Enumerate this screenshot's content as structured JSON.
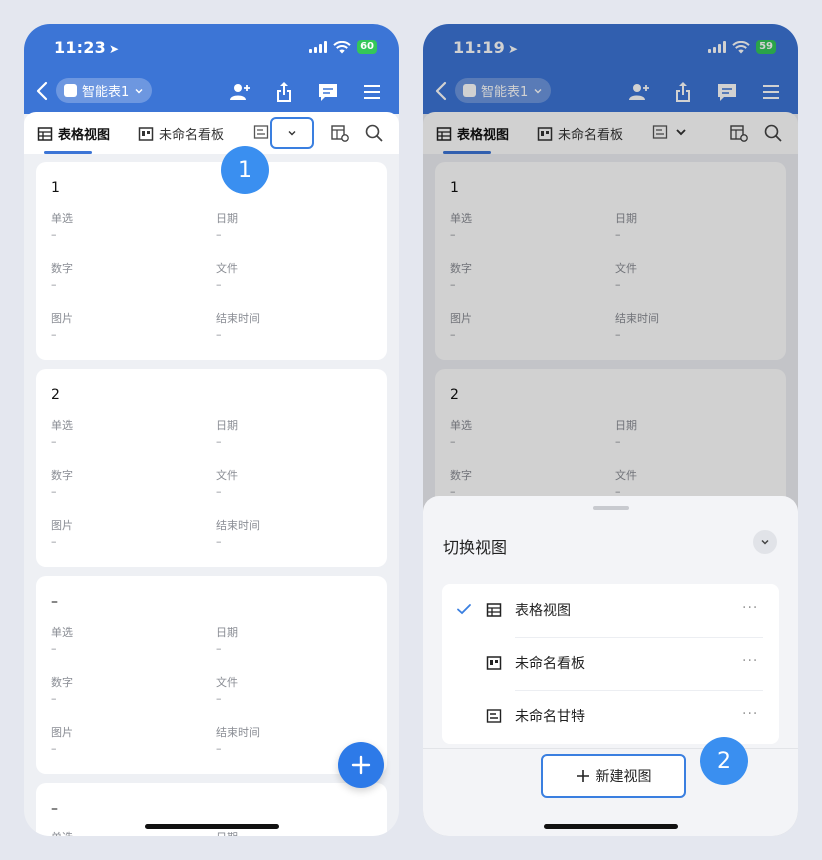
{
  "left_screen": {
    "status": {
      "time": "11:23",
      "battery": "60"
    },
    "header": {
      "doc_title": "智能表1"
    },
    "tabs": [
      {
        "label": "表格视图"
      },
      {
        "label": "未命名看板"
      }
    ],
    "records": [
      {
        "title": "1",
        "fields": [
          {
            "label": "单选",
            "value": "–"
          },
          {
            "label": "日期",
            "value": "–"
          },
          {
            "label": "数字",
            "value": "–"
          },
          {
            "label": "文件",
            "value": "–"
          },
          {
            "label": "图片",
            "value": "–"
          },
          {
            "label": "结束时间",
            "value": "–"
          }
        ]
      },
      {
        "title": "2",
        "fields": [
          {
            "label": "单选",
            "value": "–"
          },
          {
            "label": "日期",
            "value": "–"
          },
          {
            "label": "数字",
            "value": "–"
          },
          {
            "label": "文件",
            "value": "–"
          },
          {
            "label": "图片",
            "value": "–"
          },
          {
            "label": "结束时间",
            "value": "–"
          }
        ]
      },
      {
        "title": "–",
        "fields": [
          {
            "label": "单选",
            "value": "–"
          },
          {
            "label": "日期",
            "value": "–"
          },
          {
            "label": "数字",
            "value": "–"
          },
          {
            "label": "文件",
            "value": "–"
          },
          {
            "label": "图片",
            "value": "–"
          },
          {
            "label": "结束时间",
            "value": "–"
          }
        ]
      },
      {
        "title": "–",
        "fields": [
          {
            "label": "单选",
            "value": ""
          },
          {
            "label": "日期",
            "value": ""
          }
        ]
      }
    ],
    "step_badge": "1"
  },
  "right_screen": {
    "status": {
      "time": "11:19",
      "battery": "59"
    },
    "header": {
      "doc_title": "智能表1"
    },
    "tabs": [
      {
        "label": "表格视图"
      },
      {
        "label": "未命名看板"
      }
    ],
    "records": [
      {
        "title": "1",
        "fields": [
          {
            "label": "单选",
            "value": "–"
          },
          {
            "label": "日期",
            "value": "–"
          },
          {
            "label": "数字",
            "value": "–"
          },
          {
            "label": "文件",
            "value": "–"
          },
          {
            "label": "图片",
            "value": "–"
          },
          {
            "label": "结束时间",
            "value": "–"
          }
        ]
      },
      {
        "title": "2",
        "fields": [
          {
            "label": "单选",
            "value": "–"
          },
          {
            "label": "日期",
            "value": "–"
          },
          {
            "label": "数字",
            "value": "–"
          },
          {
            "label": "文件",
            "value": "–"
          }
        ]
      }
    ],
    "sheet": {
      "title": "切换视图",
      "views": [
        {
          "label": "表格视图",
          "selected": true,
          "icon": "grid-view-icon"
        },
        {
          "label": "未命名看板",
          "selected": false,
          "icon": "kanban-view-icon"
        },
        {
          "label": "未命名甘特",
          "selected": false,
          "icon": "gantt-view-icon"
        }
      ],
      "more_label": "···",
      "new_view_label": "新建视图"
    },
    "step_badge": "2"
  },
  "colors": {
    "header_blue": "#3c75d6",
    "accent": "#3a7fe0",
    "badge": "#3a8ff0",
    "fab": "#2d7ae8"
  }
}
